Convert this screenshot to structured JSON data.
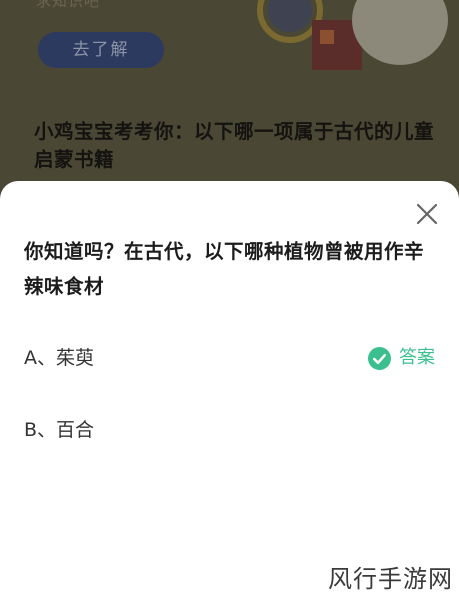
{
  "background_page": {
    "faded_text": "求知识吧",
    "learn_button_label": "去了解",
    "question_title": "小鸡宝宝考考你：以下哪一项属于古代的儿童启蒙书籍"
  },
  "modal": {
    "question": "你知道吗？在古代，以下哪种植物曾被用作辛辣味食材",
    "options": [
      {
        "label": "A、茱萸",
        "answer_label": "答案"
      },
      {
        "label": "B、百合"
      }
    ],
    "colors": {
      "accent": "#3bbf8f",
      "close_icon": "#666666"
    }
  },
  "watermark": "风行手游网"
}
